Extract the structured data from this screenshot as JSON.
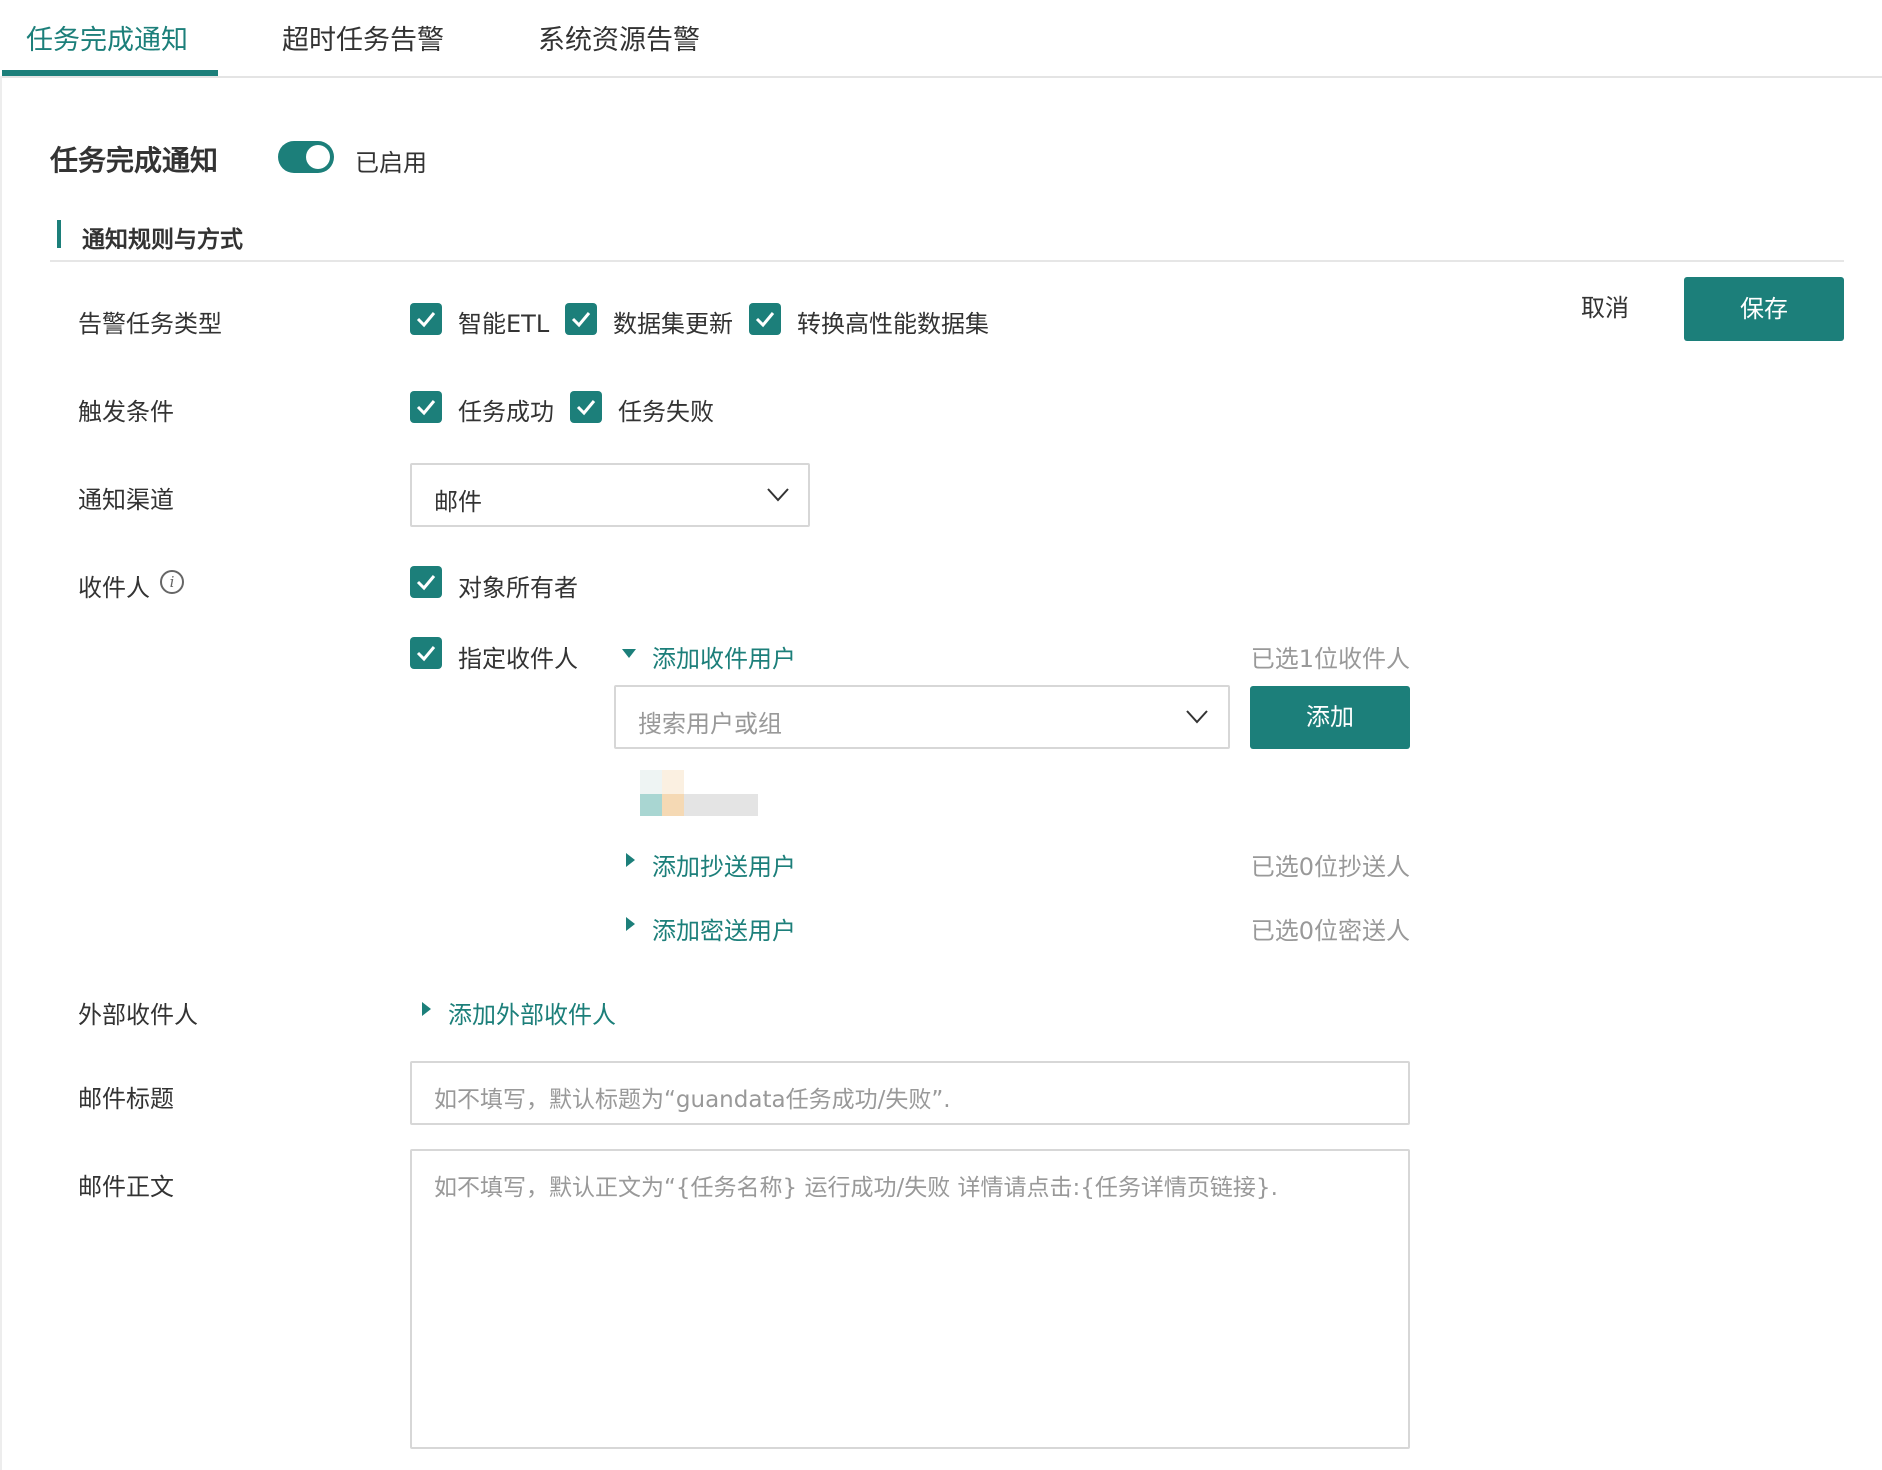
{
  "tabs": [
    {
      "label": "任务完成通知",
      "active": true
    },
    {
      "label": "超时任务告警",
      "active": false
    },
    {
      "label": "系统资源告警",
      "active": false
    }
  ],
  "header": {
    "title": "任务完成通知",
    "toggle_on": true,
    "toggle_status": "已启用"
  },
  "section": {
    "title": "通知规则与方式"
  },
  "actions": {
    "cancel_label": "取消",
    "save_label": "保存"
  },
  "form": {
    "task_type": {
      "label": "告警任务类型",
      "options": [
        {
          "label": "智能ETL",
          "checked": true
        },
        {
          "label": "数据集更新",
          "checked": true
        },
        {
          "label": "转换高性能数据集",
          "checked": true
        }
      ]
    },
    "trigger": {
      "label": "触发条件",
      "options": [
        {
          "label": "任务成功",
          "checked": true
        },
        {
          "label": "任务失败",
          "checked": true
        }
      ]
    },
    "channel": {
      "label": "通知渠道",
      "value": "邮件"
    },
    "recipients": {
      "label": "收件人",
      "owner": {
        "label": "对象所有者",
        "checked": true
      },
      "specified": {
        "label": "指定收件人",
        "checked": true
      },
      "add_to": {
        "label": "添加收件用户",
        "count": "已选1位收件人",
        "expanded": true
      },
      "search_placeholder": "搜索用户或组",
      "add_button": "添加",
      "add_cc": {
        "label": "添加抄送用户",
        "count": "已选0位抄送人"
      },
      "add_bcc": {
        "label": "添加密送用户",
        "count": "已选0位密送人"
      }
    },
    "external": {
      "label": "外部收件人",
      "link": "添加外部收件人"
    },
    "subject": {
      "label": "邮件标题",
      "placeholder": "如不填写，默认标题为“guandata任务成功/失败”."
    },
    "body": {
      "label": "邮件正文",
      "placeholder": "如不填写，默认正文为“{任务名称} 运行成功/失败 详情请点击:{任务详情页链接}."
    }
  },
  "colors": {
    "accent": "#1c7f7a",
    "muted": "#999999",
    "border": "#d7d7d7"
  }
}
